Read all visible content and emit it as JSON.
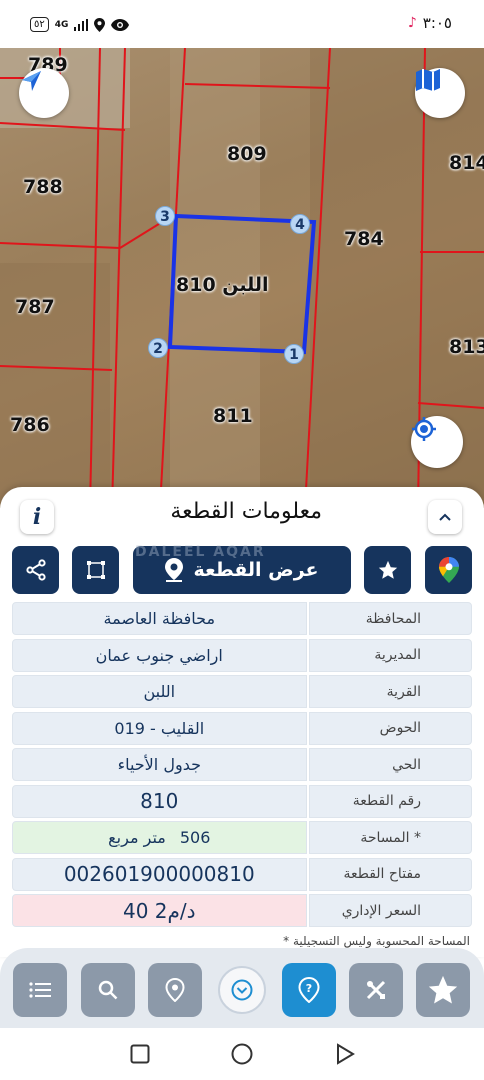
{
  "status": {
    "battery": "٥٢",
    "network": "4G",
    "time": "٣:٠٥"
  },
  "map": {
    "parcels": [
      {
        "id": "p789",
        "label": "789"
      },
      {
        "id": "p788",
        "label": "788"
      },
      {
        "id": "p787",
        "label": "787"
      },
      {
        "id": "p786",
        "label": "786"
      },
      {
        "id": "p809",
        "label": "809"
      },
      {
        "id": "p784",
        "label": "784"
      },
      {
        "id": "p811",
        "label": "811"
      },
      {
        "id": "p814",
        "label": "814"
      },
      {
        "id": "p813",
        "label": "813"
      }
    ],
    "selected_label": "اللبن 810",
    "vertices": [
      "1",
      "2",
      "3",
      "4"
    ],
    "border_color": "#e0151b",
    "selected_color": "#1a33e6"
  },
  "panel": {
    "title": "معلومات القطعة",
    "info_icon": "i",
    "show_parcel_label": "عرض القطعة",
    "watermark": "DALEEL AQAR",
    "rows": [
      {
        "label": "المحافظة",
        "value": "محافظة العاصمة"
      },
      {
        "label": "المديرية",
        "value": "اراضي جنوب عمان"
      },
      {
        "label": "القرية",
        "value": "اللبن"
      },
      {
        "label": "الحوض",
        "value": "القليب - 019"
      },
      {
        "label": "الحي",
        "value": "جدول الأحياء"
      },
      {
        "label": "رقم القطعة",
        "value": "810"
      }
    ],
    "area": {
      "label": "المساحة *",
      "number": "506",
      "unit": "متر مربع"
    },
    "key_row": {
      "label": "مفتاح القطعة",
      "value": "002601900000810"
    },
    "price_row": {
      "label": "السعر الإداري",
      "value": "40 د/م2"
    },
    "footnote": "* المساحة المحسوبة وليس التسجيلية"
  },
  "colors": {
    "primary": "#16345d",
    "accent": "#1e8ed1",
    "toolbar_button": "#8c99a9"
  }
}
